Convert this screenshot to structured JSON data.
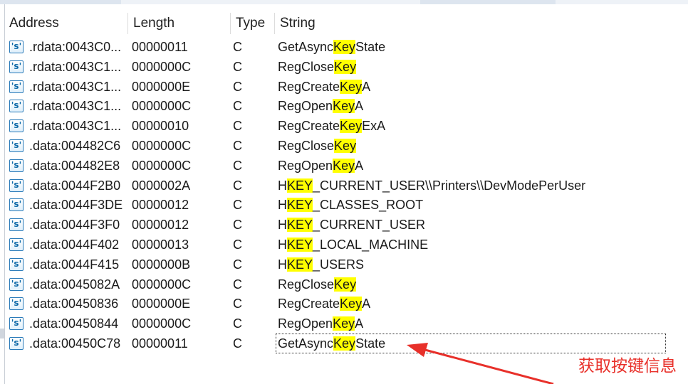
{
  "columns": {
    "address": "Address",
    "length": "Length",
    "type": "Type",
    "string": "String"
  },
  "search_term": "Key",
  "rows": [
    {
      "address": ".rdata:0043C0...",
      "length": "00000011",
      "type": "C",
      "string": "GetAsyncKeyState"
    },
    {
      "address": ".rdata:0043C1...",
      "length": "0000000C",
      "type": "C",
      "string": "RegCloseKey"
    },
    {
      "address": ".rdata:0043C1...",
      "length": "0000000E",
      "type": "C",
      "string": "RegCreateKeyA"
    },
    {
      "address": ".rdata:0043C1...",
      "length": "0000000C",
      "type": "C",
      "string": "RegOpenKeyA"
    },
    {
      "address": ".rdata:0043C1...",
      "length": "00000010",
      "type": "C",
      "string": "RegCreateKeyExA"
    },
    {
      "address": ".data:004482C6",
      "length": "0000000C",
      "type": "C",
      "string": "RegCloseKey"
    },
    {
      "address": ".data:004482E8",
      "length": "0000000C",
      "type": "C",
      "string": "RegOpenKeyA"
    },
    {
      "address": ".data:0044F2B0",
      "length": "0000002A",
      "type": "C",
      "string": "HKEY_CURRENT_USER\\\\Printers\\\\DevModePerUser"
    },
    {
      "address": ".data:0044F3DE",
      "length": "00000012",
      "type": "C",
      "string": "HKEY_CLASSES_ROOT"
    },
    {
      "address": ".data:0044F3F0",
      "length": "00000012",
      "type": "C",
      "string": "HKEY_CURRENT_USER"
    },
    {
      "address": ".data:0044F402",
      "length": "00000013",
      "type": "C",
      "string": "HKEY_LOCAL_MACHINE"
    },
    {
      "address": ".data:0044F415",
      "length": "0000000B",
      "type": "C",
      "string": "HKEY_USERS"
    },
    {
      "address": ".data:0045082A",
      "length": "0000000C",
      "type": "C",
      "string": "RegCloseKey"
    },
    {
      "address": ".data:00450836",
      "length": "0000000E",
      "type": "C",
      "string": "RegCreateKeyA"
    },
    {
      "address": ".data:00450844",
      "length": "0000000C",
      "type": "C",
      "string": "RegOpenKeyA"
    },
    {
      "address": ".data:00450C78",
      "length": "00000011",
      "type": "C",
      "string": "GetAsyncKeyState",
      "focused": true
    }
  ],
  "row_icon": "string-icon",
  "icon_glyph": "'s'",
  "annotation": "获取按键信息",
  "colors": {
    "highlight": "#ffff00",
    "annotation": "#e8302a",
    "icon_border": "#2b7bb9"
  }
}
